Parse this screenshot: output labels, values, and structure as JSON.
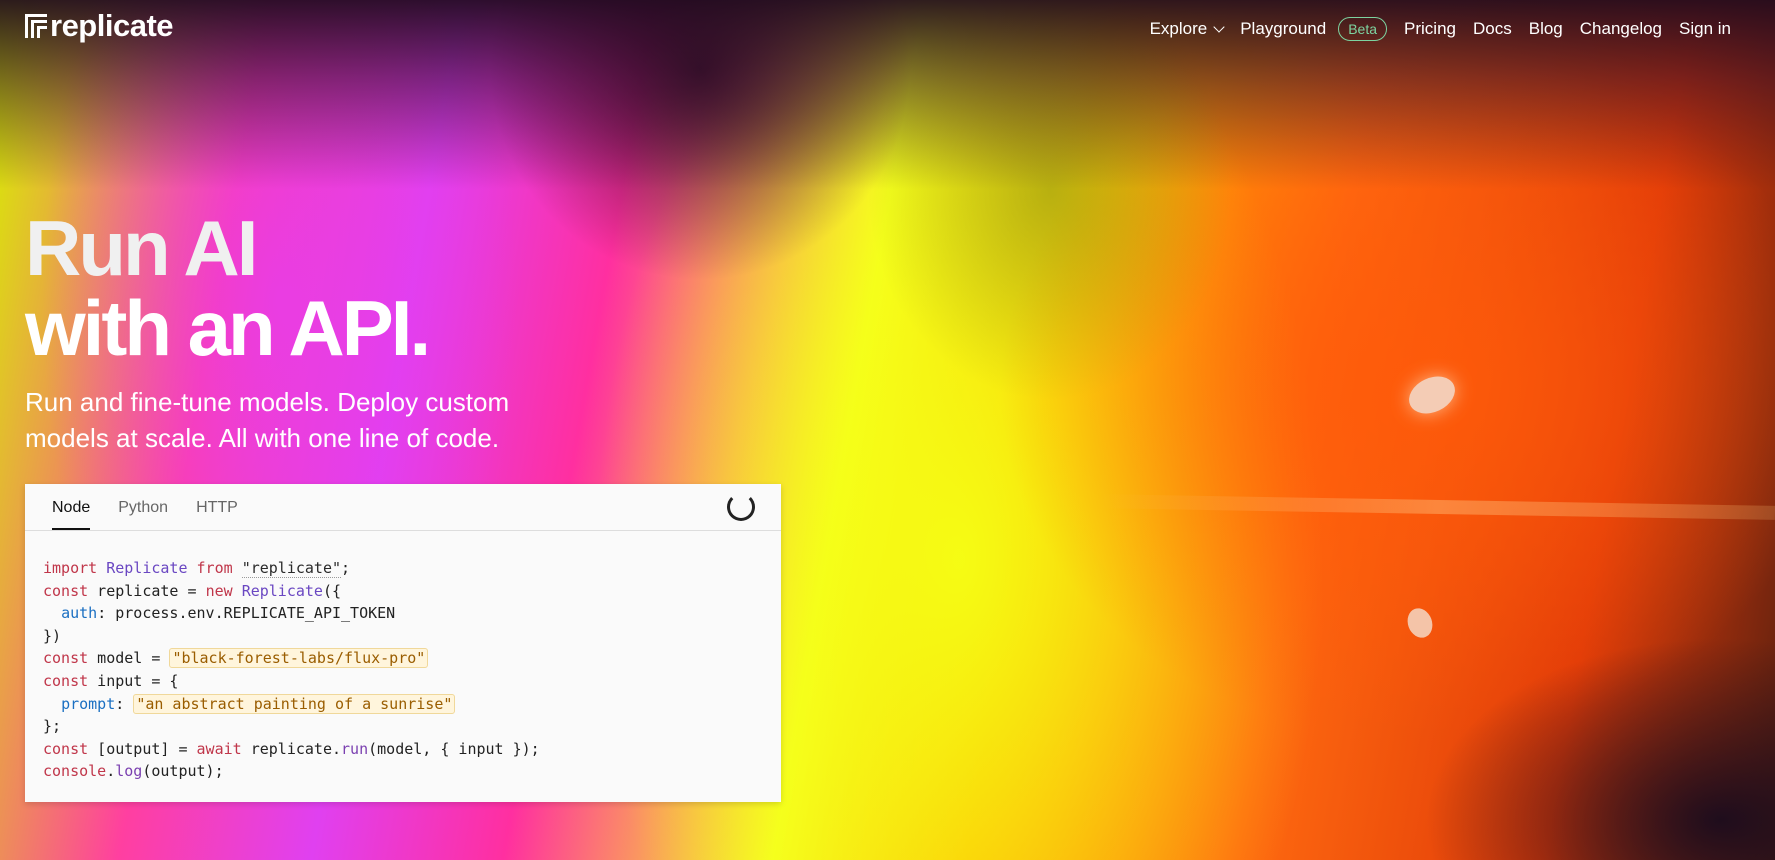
{
  "nav": {
    "logo_text": "replicate",
    "items": [
      {
        "label": "Explore"
      },
      {
        "label": "Playground"
      },
      {
        "label": "Beta"
      },
      {
        "label": "Pricing"
      },
      {
        "label": "Docs"
      },
      {
        "label": "Blog"
      },
      {
        "label": "Changelog"
      },
      {
        "label": "Sign in"
      }
    ]
  },
  "hero": {
    "title_line1": "Run AI",
    "title_line2": "with an API.",
    "subtitle": "Run and fine-tune models. Deploy custom models at scale. All with one line of code."
  },
  "code_card": {
    "tabs": [
      "Node",
      "Python",
      "HTTP"
    ],
    "active_tab": "Node",
    "lines": [
      "import Replicate from \"replicate\";",
      "const replicate = new Replicate({",
      "  auth: process.env.REPLICATE_API_TOKEN",
      "})",
      "const model = \"black-forest-labs/flux-pro\"",
      "const input = {",
      "  prompt: \"an abstract painting of a sunrise\"",
      "};",
      "const [output] = await replicate.run(model, { input });",
      "console.log(output);"
    ],
    "tokens": {
      "import": "import",
      "Replicate": "Replicate",
      "from": "from",
      "replicate_str": "\"replicate\"",
      "const": "const",
      "new": "new",
      "auth": "auth",
      "env": "process.env.REPLICATE_API_TOKEN",
      "model_str": "\"black-forest-labs/flux-pro\"",
      "prompt": "prompt",
      "prompt_str": "\"an abstract painting of a sunrise\"",
      "await": "await",
      "run": "run",
      "console": "console",
      "log": "log"
    }
  },
  "colors": {
    "keyword": "#c0364a",
    "class": "#6a47c2",
    "property": "#1a6fc2",
    "string_highlight_bg": "#fff5dc",
    "beta_badge": "#7dd3a0"
  }
}
